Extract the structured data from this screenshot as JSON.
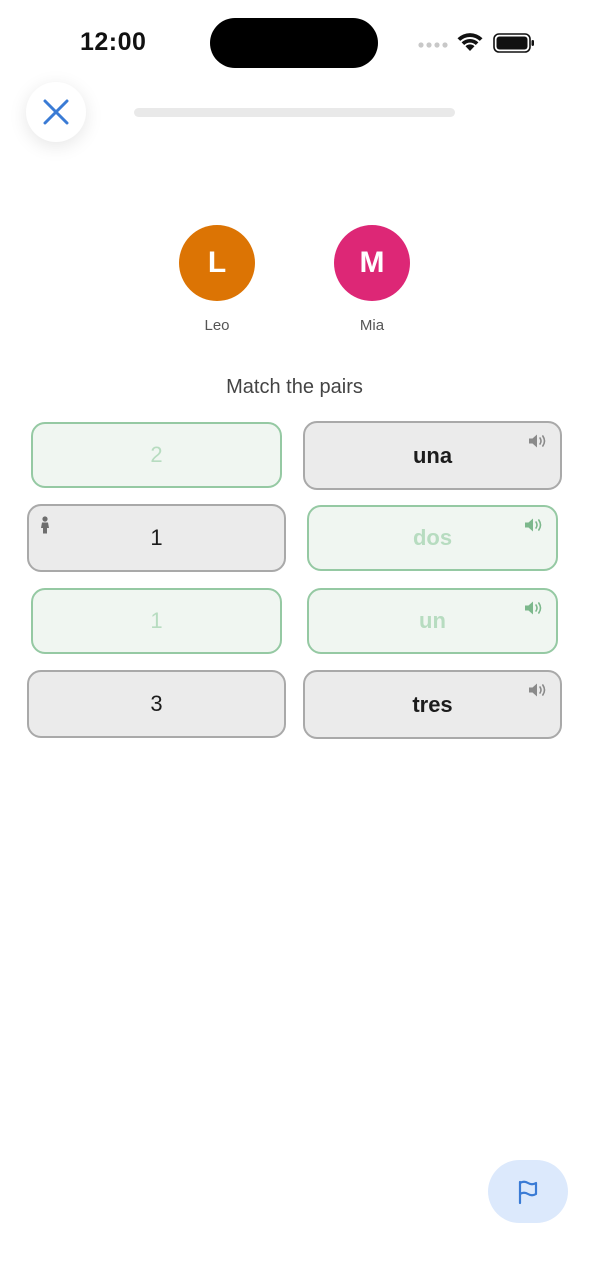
{
  "status_bar": {
    "time": "12:00"
  },
  "header": {
    "close_icon": "close-icon",
    "progress_fraction": 0.0
  },
  "players": [
    {
      "initial": "L",
      "name": "Leo",
      "color": "#dc7404"
    },
    {
      "initial": "M",
      "name": "Mia",
      "color": "#dd2776"
    }
  ],
  "prompt": "Match the pairs",
  "cards": {
    "left": [
      {
        "text": "2",
        "state": "matched"
      },
      {
        "text": "1",
        "state": "default",
        "icon": "person-icon"
      },
      {
        "text": "1",
        "state": "matched"
      },
      {
        "text": "3",
        "state": "default"
      }
    ],
    "right": [
      {
        "text": "una",
        "state": "default",
        "icon": "speaker-icon"
      },
      {
        "text": "dos",
        "state": "matched",
        "icon": "speaker-icon"
      },
      {
        "text": "un",
        "state": "matched",
        "icon": "speaker-icon"
      },
      {
        "text": "tres",
        "state": "default",
        "icon": "speaker-icon"
      }
    ]
  },
  "footer": {
    "flag_icon": "flag-icon"
  },
  "colors": {
    "accent_blue": "#3a7bd5",
    "matched_border": "#95c9a3",
    "matched_text": "#b7dcc0",
    "flag_bg": "#dce9fc"
  }
}
